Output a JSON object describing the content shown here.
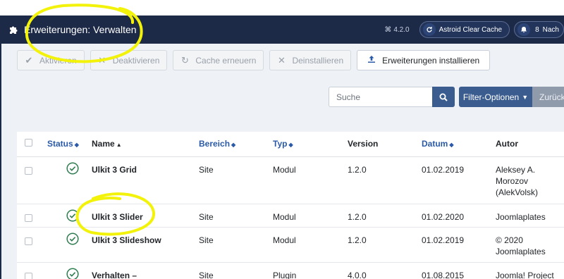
{
  "header": {
    "title": "Erweiterungen: Verwalten",
    "version": "4.2.0",
    "cache_button": "Astroid Clear Cache",
    "notifications_count": "8",
    "messages_label": "Nach"
  },
  "toolbar": {
    "activate": "Aktivieren",
    "deactivate": "Deaktivieren",
    "refresh_cache": "Cache erneuern",
    "uninstall": "Deinstallieren",
    "install": "Erweiterungen installieren"
  },
  "search": {
    "placeholder": "Suche",
    "filter_options": "Filter-Optionen",
    "reset": "Zurücksetzen"
  },
  "table": {
    "headers": {
      "status": "Status",
      "name": "Name",
      "area": "Bereich",
      "type": "Typ",
      "version": "Version",
      "date": "Datum",
      "author": "Autor"
    },
    "rows": [
      {
        "name": "Ulkit 3 Grid",
        "area": "Site",
        "type": "Modul",
        "version": "1.2.0",
        "date": "01.02.2019",
        "author": "Aleksey A. Morozov (AlekVolsk)"
      },
      {
        "name": "Ulkit 3 Slider",
        "area": "Site",
        "type": "Modul",
        "version": "1.2.0",
        "date": "01.02.2020",
        "author": "Joomlaplates"
      },
      {
        "name": "Ulkit 3 Slideshow",
        "area": "Site",
        "type": "Modul",
        "version": "1.2.0",
        "date": "01.02.2019",
        "author": "© 2020 Joomlaplates"
      },
      {
        "name": "Verhalten –",
        "area": "Site",
        "type": "Plugin",
        "version": "4.0.0",
        "date": "01.08.2015",
        "author": "Joomla! Project"
      }
    ]
  },
  "colors": {
    "header_bg": "#1c2a47",
    "primary": "#3b5c8f",
    "link": "#2a5aa8",
    "status_ok": "#2e7d4f",
    "annotation": "#f2f20a"
  }
}
